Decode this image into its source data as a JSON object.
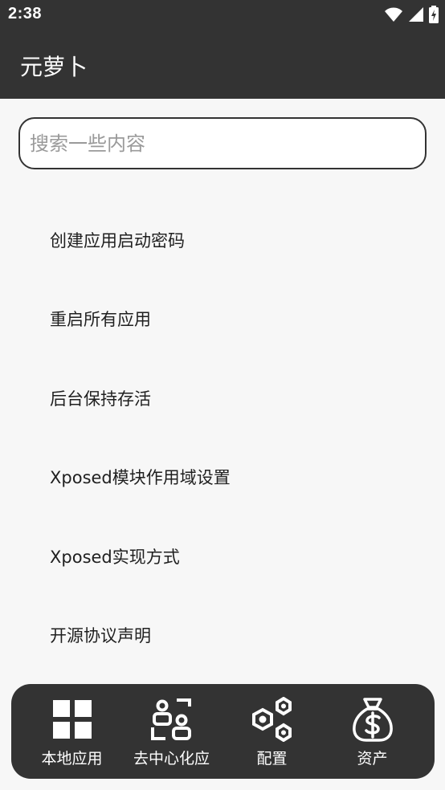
{
  "status_bar": {
    "time": "2:38",
    "icons": [
      "wifi-icon",
      "signal-icon",
      "battery-charging-icon"
    ]
  },
  "app_bar": {
    "title": "元萝卜"
  },
  "search": {
    "placeholder": "搜索一些内容",
    "value": ""
  },
  "menu": {
    "items": [
      {
        "label": "创建应用启动密码"
      },
      {
        "label": "重启所有应用"
      },
      {
        "label": "后台保持存活"
      },
      {
        "label": "Xposed模块作用域设置"
      },
      {
        "label": "Xposed实现方式"
      },
      {
        "label": "开源协议声明"
      }
    ]
  },
  "bottom_nav": {
    "items": [
      {
        "label": "本地应用",
        "icon": "grid-apps-icon"
      },
      {
        "label": "去中心化应",
        "icon": "decentralized-users-icon"
      },
      {
        "label": "配置",
        "icon": "hexagon-nodes-icon"
      },
      {
        "label": "资产",
        "icon": "money-bag-icon"
      }
    ]
  },
  "colors": {
    "bar_background": "#333333",
    "page_background": "#f7f7f7",
    "text_primary": "#1f1f1f",
    "placeholder": "#9a9a9a"
  }
}
